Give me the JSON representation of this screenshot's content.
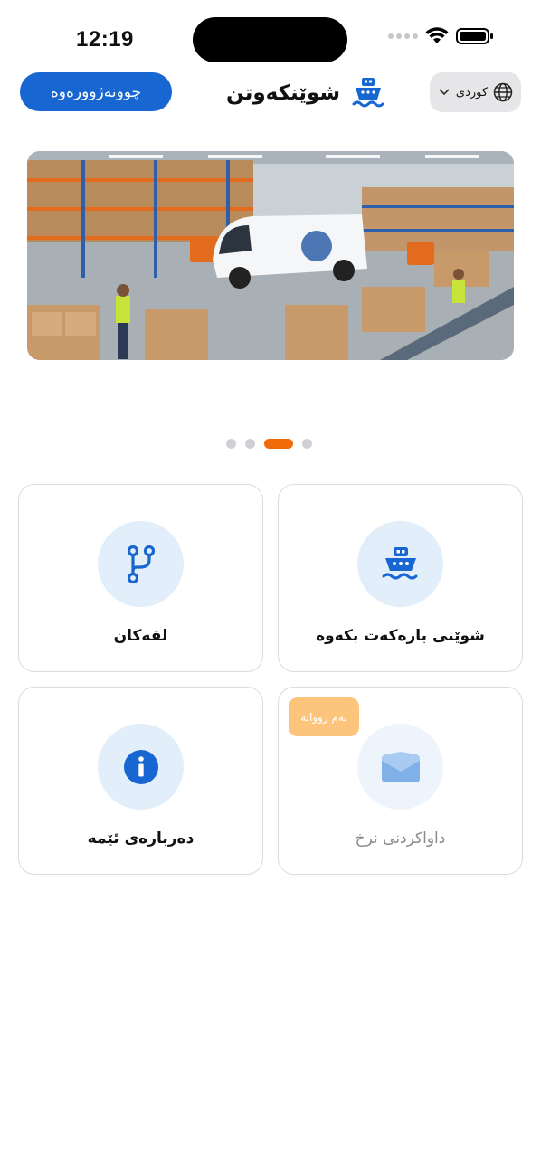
{
  "status_bar": {
    "time": "12:19"
  },
  "header": {
    "login_label": "چوونەژوورەوە",
    "app_title": "شوێنکەوتن",
    "language_label": "کوردی"
  },
  "carousel": {
    "slide_count": 4,
    "active_index": 2
  },
  "tiles": [
    {
      "label": "شوێنی بارەکەت بکەوە",
      "icon": "ship-icon"
    },
    {
      "label": "لقەکان",
      "icon": "branch-icon"
    },
    {
      "label": "داواکردنی نرخ",
      "icon": "envelope-icon",
      "badge": "بەم زووانە",
      "disabled": true
    },
    {
      "label": "دەربارەی ئێمە",
      "icon": "info-icon"
    }
  ],
  "colors": {
    "primary": "#1766d1",
    "accent": "#f26b0a",
    "badge": "#fdc57c",
    "icon_bg": "#e3eefb"
  }
}
